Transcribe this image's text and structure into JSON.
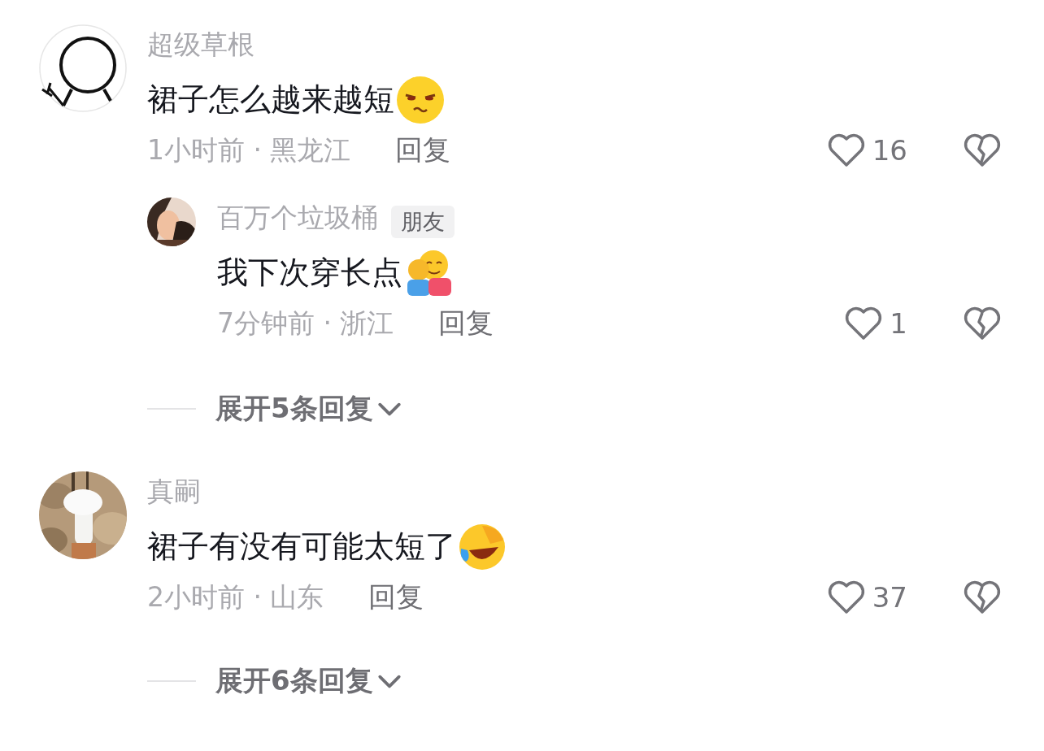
{
  "comments": [
    {
      "avatar": {
        "kind": "doodle"
      },
      "username": "超级草根",
      "text": "裙子怎么越来越短",
      "emoji": {
        "kind": "smirk"
      },
      "meta": "1小时前 · 黑龙江",
      "reply_label": "回复",
      "likes": "16",
      "replies": [
        {
          "username": "百万个垃圾桶",
          "badge": "朋友",
          "text": "我下次穿长点",
          "emoji": {
            "kind": "hug"
          },
          "meta": "7分钟前 · 浙江",
          "reply_label": "回复",
          "likes": "1"
        }
      ],
      "expand": "展开5条回复"
    },
    {
      "username": "真嗣",
      "text": "裙子有没有可能太短了",
      "emoji": {
        "kind": "laugh"
      },
      "meta": "2小时前 · 山东",
      "reply_label": "回复",
      "likes": "37",
      "expand": "展开6条回复"
    }
  ]
}
